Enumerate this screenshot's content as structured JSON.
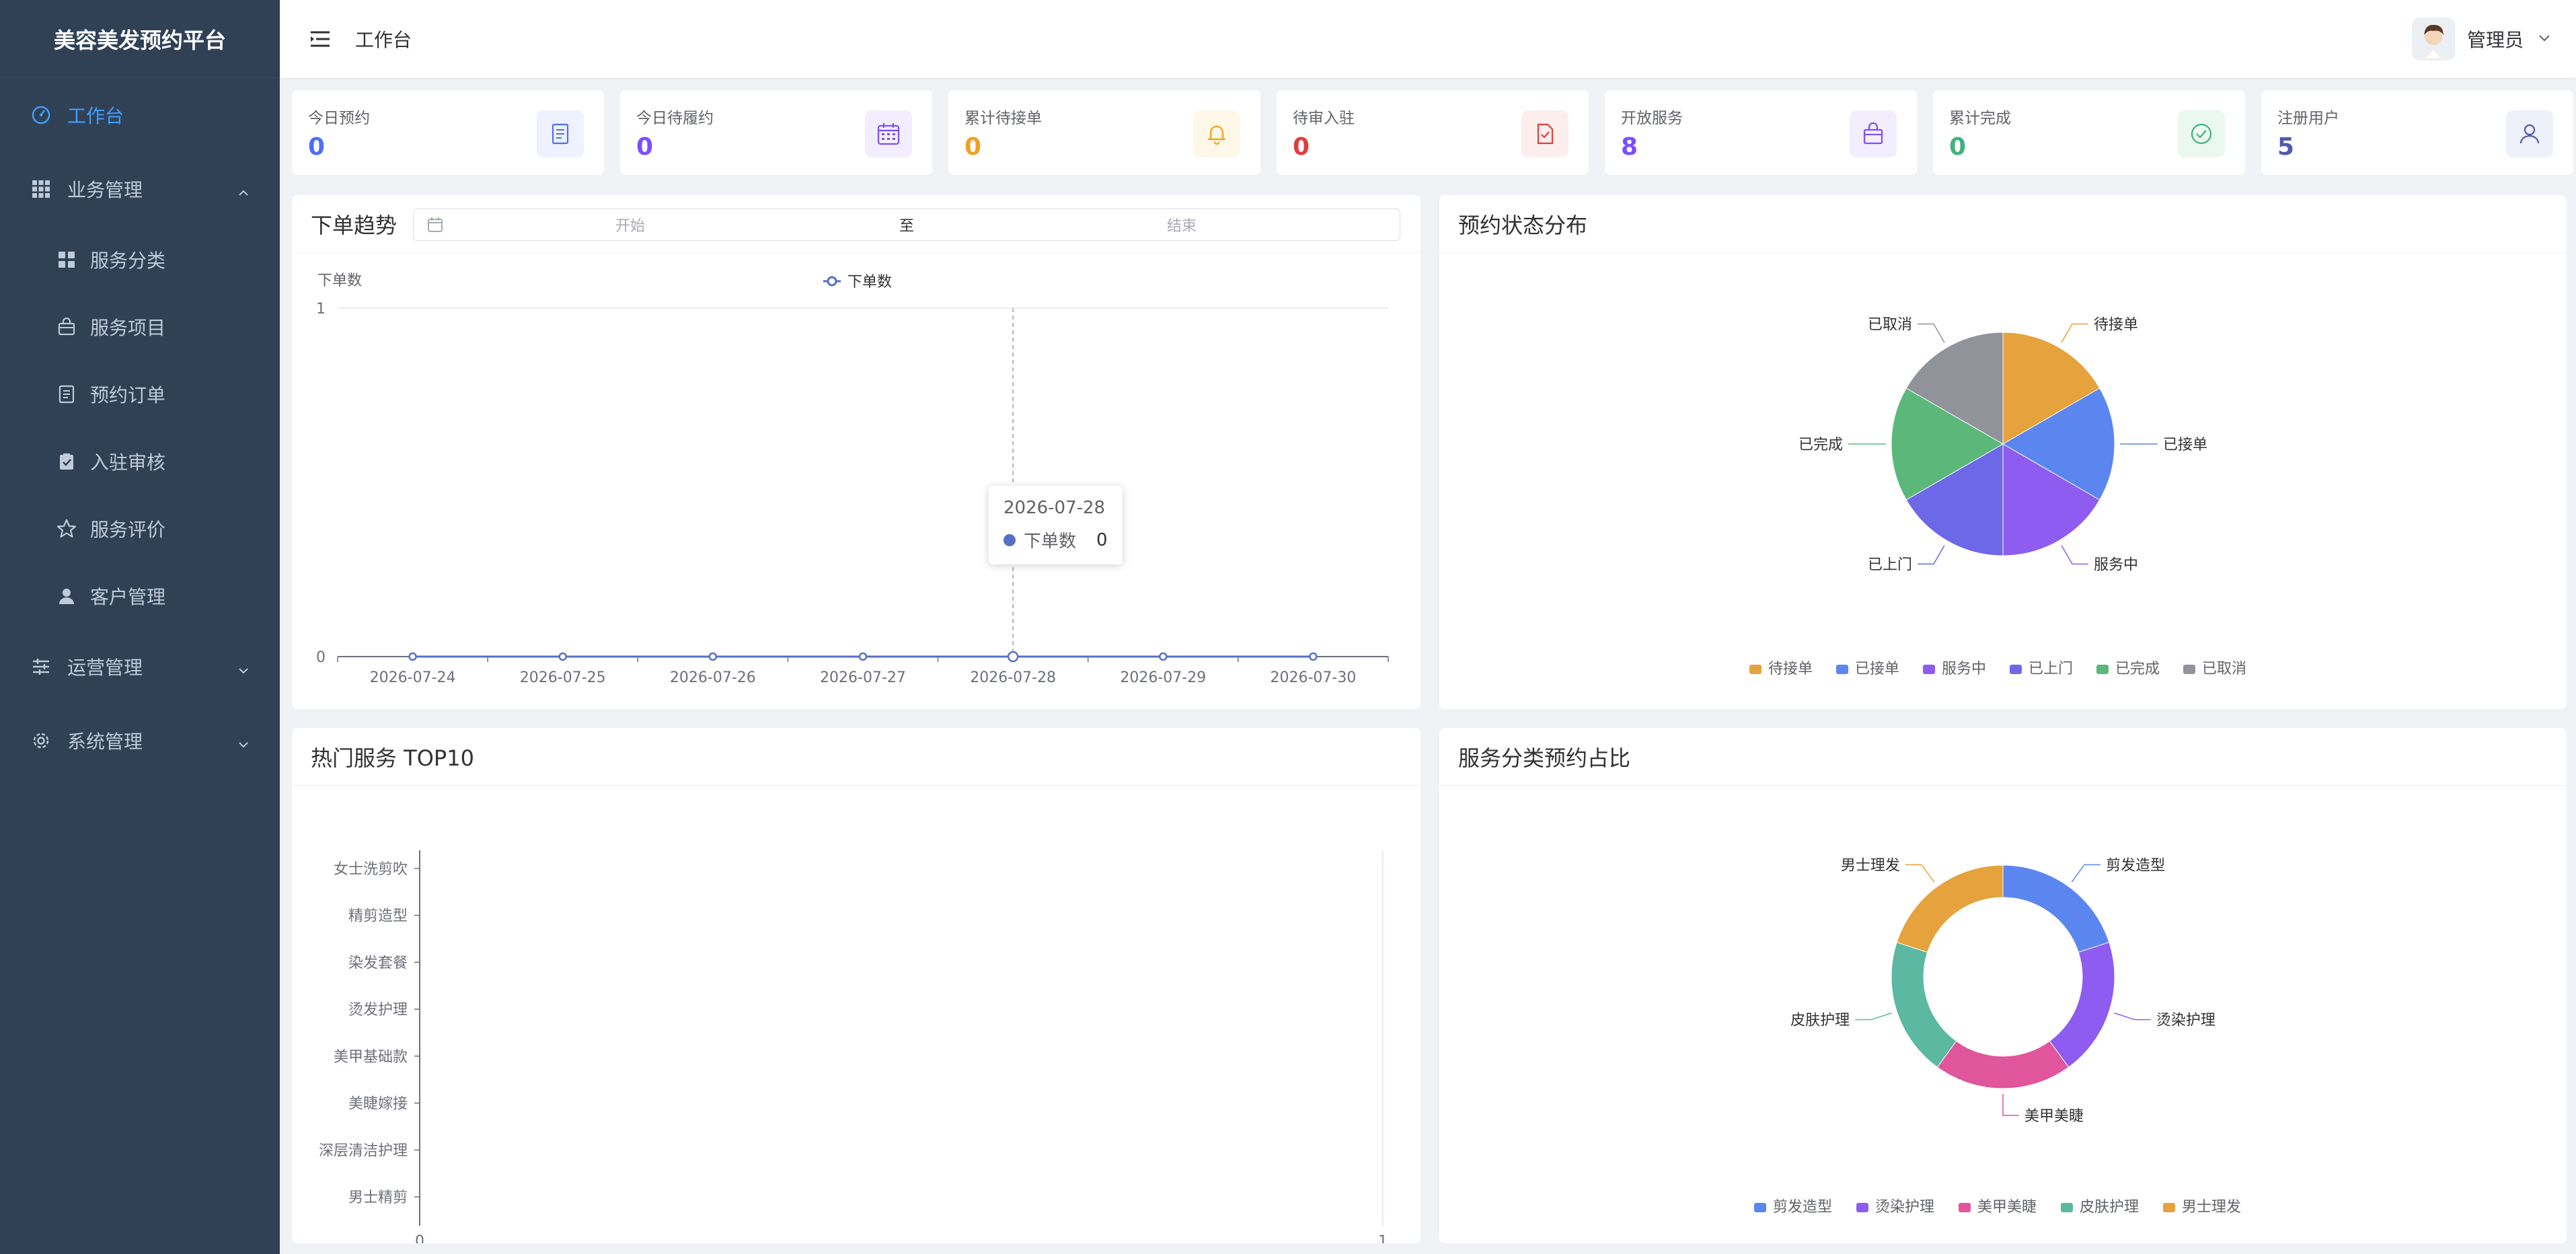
{
  "app": {
    "title": "美容美发预约平台"
  },
  "sidebar": {
    "items": [
      {
        "label": "工作台",
        "icon": "dashboard-icon",
        "active": true
      },
      {
        "label": "业务管理",
        "icon": "grid-icon",
        "expanded": true,
        "children": [
          {
            "label": "服务分类",
            "icon": "category-icon"
          },
          {
            "label": "服务项目",
            "icon": "bag-icon"
          },
          {
            "label": "预约订单",
            "icon": "document-icon"
          },
          {
            "label": "入驻审核",
            "icon": "clipboard-check-icon"
          },
          {
            "label": "服务评价",
            "icon": "star-icon"
          },
          {
            "label": "客户管理",
            "icon": "user-icon"
          }
        ]
      },
      {
        "label": "运营管理",
        "icon": "sliders-icon",
        "expanded": false
      },
      {
        "label": "系统管理",
        "icon": "gear-icon",
        "expanded": false
      }
    ]
  },
  "header": {
    "breadcrumb": "工作台",
    "user": "管理员"
  },
  "stats": [
    {
      "label": "今日预约",
      "value": "0",
      "color": "#4f6ef7",
      "bg": "#eef2ff",
      "icon": "document-icon"
    },
    {
      "label": "今日待履约",
      "value": "0",
      "color": "#7c4dff",
      "bg": "#f3eeff",
      "icon": "calendar-icon"
    },
    {
      "label": "累计待接单",
      "value": "0",
      "color": "#f0a020",
      "bg": "#fff7e8",
      "icon": "bell-icon"
    },
    {
      "label": "待审入驻",
      "value": "0",
      "color": "#e03e3e",
      "bg": "#fdeeee",
      "icon": "file-check-icon"
    },
    {
      "label": "开放服务",
      "value": "8",
      "color": "#7c4dff",
      "bg": "#f3eeff",
      "icon": "bag-icon"
    },
    {
      "label": "累计完成",
      "value": "0",
      "color": "#3fb27f",
      "bg": "#eaf8f1",
      "icon": "check-circle-icon"
    },
    {
      "label": "注册用户",
      "value": "5",
      "color": "#4f58b0",
      "bg": "#eef0fa",
      "icon": "user-icon"
    }
  ],
  "trend": {
    "title": "下单趋势",
    "range": {
      "start_placeholder": "开始",
      "separator": "至",
      "end_placeholder": "结束"
    },
    "tooltip": {
      "date": "2026-07-28",
      "series": "下单数",
      "value": "0"
    }
  },
  "status_panel": {
    "title": "预约状态分布"
  },
  "top_services": {
    "title": "热门服务 TOP10"
  },
  "category_panel": {
    "title": "服务分类预约占比"
  },
  "chart_data": [
    {
      "type": "line",
      "title": "下单趋势",
      "ylabel": "下单数",
      "x": [
        "2026-07-24",
        "2026-07-25",
        "2026-07-26",
        "2026-07-27",
        "2026-07-28",
        "2026-07-29",
        "2026-07-30"
      ],
      "series": [
        {
          "name": "下单数",
          "values": [
            0,
            0,
            0,
            0,
            0,
            0,
            0
          ],
          "color": "#5470c6"
        }
      ],
      "ylim": [
        0,
        1
      ],
      "yticks": [
        "0",
        "1"
      ],
      "legend": "top-center",
      "grid": true
    },
    {
      "type": "pie",
      "title": "预约状态分布",
      "labels": [
        "待接单",
        "已接单",
        "服务中",
        "已上门",
        "已完成",
        "已取消"
      ],
      "values": [
        1,
        1,
        1,
        1,
        1,
        1
      ],
      "colors": [
        "#e6a23c",
        "#5b86f0",
        "#8e5cf0",
        "#6c68e8",
        "#5cb87a",
        "#909399"
      ],
      "legend": "bottom"
    },
    {
      "type": "bar",
      "title": "热门服务 TOP10",
      "categories": [
        "女士洗剪吹",
        "精剪造型",
        "染发套餐",
        "烫发护理",
        "美甲基础款",
        "美睫嫁接",
        "深层清洁护理",
        "男士精剪"
      ],
      "values": [
        0,
        0,
        0,
        0,
        0,
        0,
        0,
        0
      ],
      "orientation": "horizontal",
      "xlim": [
        0,
        1
      ],
      "xticks": [
        "0",
        "1"
      ]
    },
    {
      "type": "pie",
      "title": "服务分类预约占比",
      "labels": [
        "剪发造型",
        "烫染护理",
        "美甲美睫",
        "皮肤护理",
        "男士理发"
      ],
      "values": [
        1,
        1,
        1,
        1,
        1
      ],
      "colors": [
        "#5b86f0",
        "#8e5cf0",
        "#e0559b",
        "#5cb8a0",
        "#e6a23c"
      ],
      "donut": true,
      "legend": "bottom"
    }
  ]
}
